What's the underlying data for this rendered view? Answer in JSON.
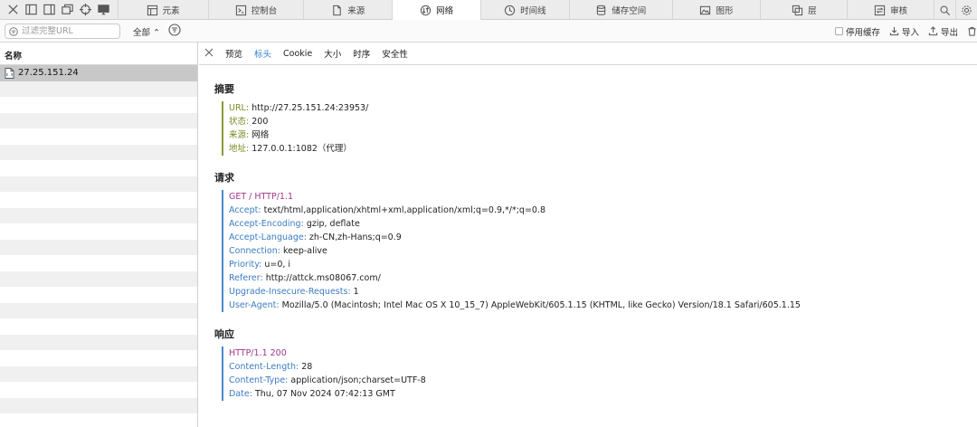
{
  "tabs": [
    {
      "label": "元素",
      "icon": "elements-icon"
    },
    {
      "label": "控制台",
      "icon": "console-icon"
    },
    {
      "label": "来源",
      "icon": "sources-icon"
    },
    {
      "label": "网络",
      "icon": "network-icon",
      "active": true
    },
    {
      "label": "时间线",
      "icon": "timeline-icon"
    },
    {
      "label": "储存空间",
      "icon": "storage-icon"
    },
    {
      "label": "图形",
      "icon": "graphics-icon"
    },
    {
      "label": "层",
      "icon": "layers-icon"
    },
    {
      "label": "审核",
      "icon": "audit-icon"
    }
  ],
  "filter": {
    "placeholder": "过滤完整URL",
    "scope": "全部 ⌃",
    "disable_cache": "停用缓存",
    "import": "导入",
    "export": "导出"
  },
  "list": {
    "header": "名称",
    "items": [
      "27.25.151.24"
    ]
  },
  "detail_tabs": {
    "preview": "预览",
    "headers": "标头",
    "cookie": "Cookie",
    "size": "大小",
    "timing": "时序",
    "security": "安全性"
  },
  "summary": {
    "title": "摘要",
    "url_key": "URL:",
    "url_val": "http://27.25.151.24:23953/",
    "status_key": "状态:",
    "status_val": "200",
    "source_key": "来源:",
    "source_val": "网络",
    "address_key": "地址:",
    "address_val": "127.0.0.1:1082（代理）"
  },
  "request": {
    "title": "请求",
    "first_line": "GET / HTTP/1.1",
    "headers": [
      {
        "k": "Accept:",
        "v": "text/html,application/xhtml+xml,application/xml;q=0.9,*/*;q=0.8"
      },
      {
        "k": "Accept-Encoding:",
        "v": "gzip, deflate"
      },
      {
        "k": "Accept-Language:",
        "v": "zh-CN,zh-Hans;q=0.9"
      },
      {
        "k": "Connection:",
        "v": "keep-alive"
      },
      {
        "k": "Priority:",
        "v": "u=0, i"
      },
      {
        "k": "Referer:",
        "v": "http://attck.ms08067.com/"
      },
      {
        "k": "Upgrade-Insecure-Requests:",
        "v": "1"
      },
      {
        "k": "User-Agent:",
        "v": "Mozilla/5.0 (Macintosh; Intel Mac OS X 10_15_7) AppleWebKit/605.1.15 (KHTML, like Gecko) Version/18.1 Safari/605.1.15"
      }
    ]
  },
  "response": {
    "title": "响应",
    "first_line": "HTTP/1.1 200",
    "headers": [
      {
        "k": "Content-Length:",
        "v": "28"
      },
      {
        "k": "Content-Type:",
        "v": "application/json;charset=UTF-8"
      },
      {
        "k": "Date:",
        "v": "Thu, 07 Nov 2024 07:42:13 GMT"
      }
    ]
  },
  "colors": {
    "active_tab_text": "#2f7fd1",
    "summary_key": "#7a8a25",
    "header_key": "#3b7cc3",
    "first_line": "#a2378a"
  }
}
